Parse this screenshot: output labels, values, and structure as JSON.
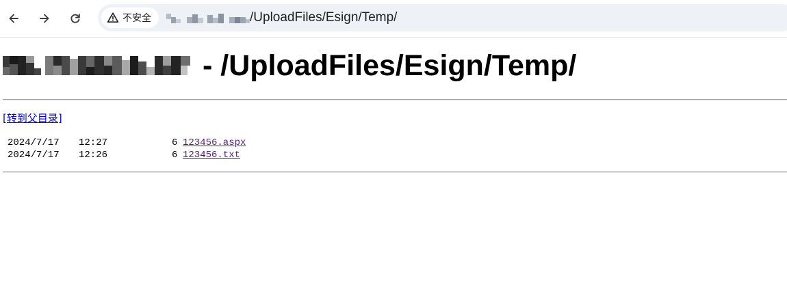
{
  "browser": {
    "back_icon": "arrow-left-icon",
    "forward_icon": "arrow-right-icon",
    "reload_icon": "reload-icon",
    "security_icon": "warning-triangle-icon",
    "security_label": "不安全",
    "url_path": "/UploadFiles/Esign/Temp/"
  },
  "page": {
    "title_path": "- /UploadFiles/Esign/Temp/",
    "parent_link": "[转到父目录]",
    "files": [
      {
        "date": "2024/7/17",
        "time": "12:27",
        "size": "6",
        "name": "123456.aspx"
      },
      {
        "date": "2024/7/17",
        "time": "12:26",
        "size": "6",
        "name": "123456.txt"
      }
    ]
  }
}
